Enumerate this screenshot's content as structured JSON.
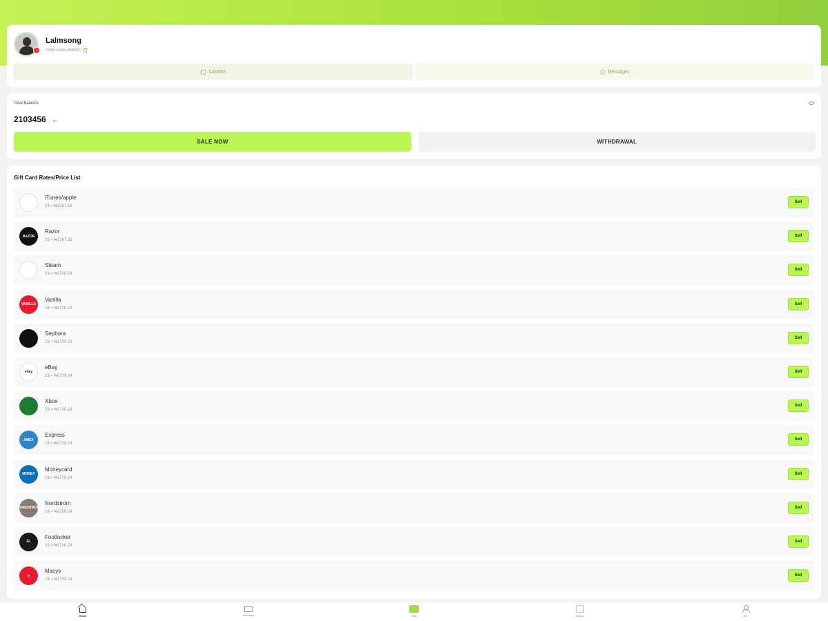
{
  "profile": {
    "username": "Lalmsong",
    "invite_text": "Invite code:368840",
    "contact_label": "Contact",
    "messages_label": "Messages"
  },
  "balance": {
    "label": "Total Balance",
    "value": "2103456",
    "unit": "ngn",
    "sell_now_label": "SALE NOW",
    "withdrawal_label": "WITHDRAWAL"
  },
  "list": {
    "title": "Gift Card Rates/Price List",
    "sell_label": "Sell",
    "items": [
      {
        "name": "iTunes/apple",
        "rate": "1$ = ₦1267.36",
        "logo_text": "",
        "logo_bg": "#ffffff",
        "icon": "apple-logo-icon"
      },
      {
        "name": "Razor",
        "rate": "1$ = ₦1267.36",
        "logo_text": "RAZOR",
        "logo_bg": "#111111",
        "icon": "razor-logo-icon"
      },
      {
        "name": "Steam",
        "rate": "1$ = ₦1708.24",
        "logo_text": "",
        "logo_bg": "#ffffff",
        "icon": "steam-logo-icon"
      },
      {
        "name": "Vanilla",
        "rate": "1$ = ₦1708.24",
        "logo_text": "VANILLA",
        "logo_bg": "#e11d2f",
        "icon": "vanilla-logo-icon"
      },
      {
        "name": "Sephora",
        "rate": "1$ = ₦1708.24",
        "logo_text": "",
        "logo_bg": "#111111",
        "icon": "sephora-logo-icon"
      },
      {
        "name": "eBay",
        "rate": "1$ = ₦1708.24",
        "logo_text": "ebay",
        "logo_bg": "#ffffff",
        "icon": "ebay-logo-icon"
      },
      {
        "name": "Xbox",
        "rate": "1$ = ₦1708.24",
        "logo_text": "",
        "logo_bg": "#1f7a34",
        "icon": "xbox-logo-icon"
      },
      {
        "name": "Express",
        "rate": "1$ = ₦1708.24",
        "logo_text": "AMEX",
        "logo_bg": "#2e86c9",
        "icon": "express-logo-icon"
      },
      {
        "name": "Moneycard",
        "rate": "1$ = ₦1708.24",
        "logo_text": "MONEY",
        "logo_bg": "#0d6fb8",
        "icon": "moneycard-logo-icon"
      },
      {
        "name": "Nordstrom",
        "rate": "1$ = ₦1708.24",
        "logo_text": "NORDSTROM",
        "logo_bg": "#8a7b72",
        "icon": "nordstrom-logo-icon"
      },
      {
        "name": "Footlocker",
        "rate": "1$ = ₦1708.24",
        "logo_text": "FL",
        "logo_bg": "#1a1a1a",
        "icon": "footlocker-logo-icon"
      },
      {
        "name": "Macys",
        "rate": "1$ = ₦1708.24",
        "logo_text": "★",
        "logo_bg": "#e11d2f",
        "icon": "macys-logo-icon"
      }
    ]
  },
  "nav": {
    "items": [
      {
        "label": "Home",
        "icon": "home-icon"
      },
      {
        "label": "Message",
        "icon": "message-icon"
      },
      {
        "label": "Sale",
        "icon": "sell-icon"
      },
      {
        "label": "History",
        "icon": "history-icon"
      },
      {
        "label": "Me",
        "icon": "user-icon"
      }
    ]
  },
  "colors": {
    "accent": "#baf653",
    "gradient_start": "#c4f254",
    "gradient_end": "#92cf3d"
  }
}
